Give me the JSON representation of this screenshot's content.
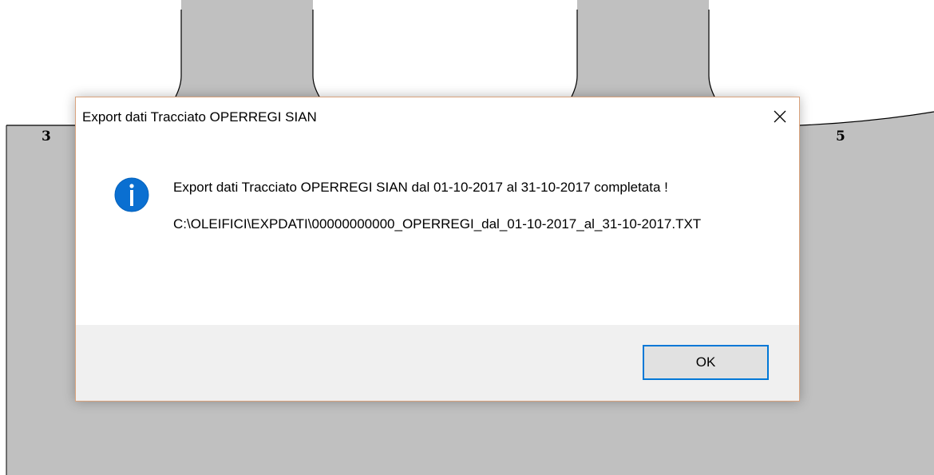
{
  "background": {
    "label_left": "3",
    "label_right": "5"
  },
  "dialog": {
    "title": "Export dati Tracciato OPERREGI SIAN",
    "close_icon": "close-icon",
    "info_icon": "info-icon",
    "message_line": "Export dati Tracciato OPERREGI SIAN dal 01-10-2017 al 31-10-2017 completata !",
    "file_path": "C:\\OLEIFICI\\EXPDATI\\00000000000_OPERREGI_dal_01-10-2017_al_31-10-2017.TXT",
    "ok_label": "OK"
  },
  "colors": {
    "accent": "#0078d7",
    "dialog_border": "#d9a27c",
    "footer_bg": "#f0f0f0",
    "drawing_fill": "#c0c0c0"
  }
}
